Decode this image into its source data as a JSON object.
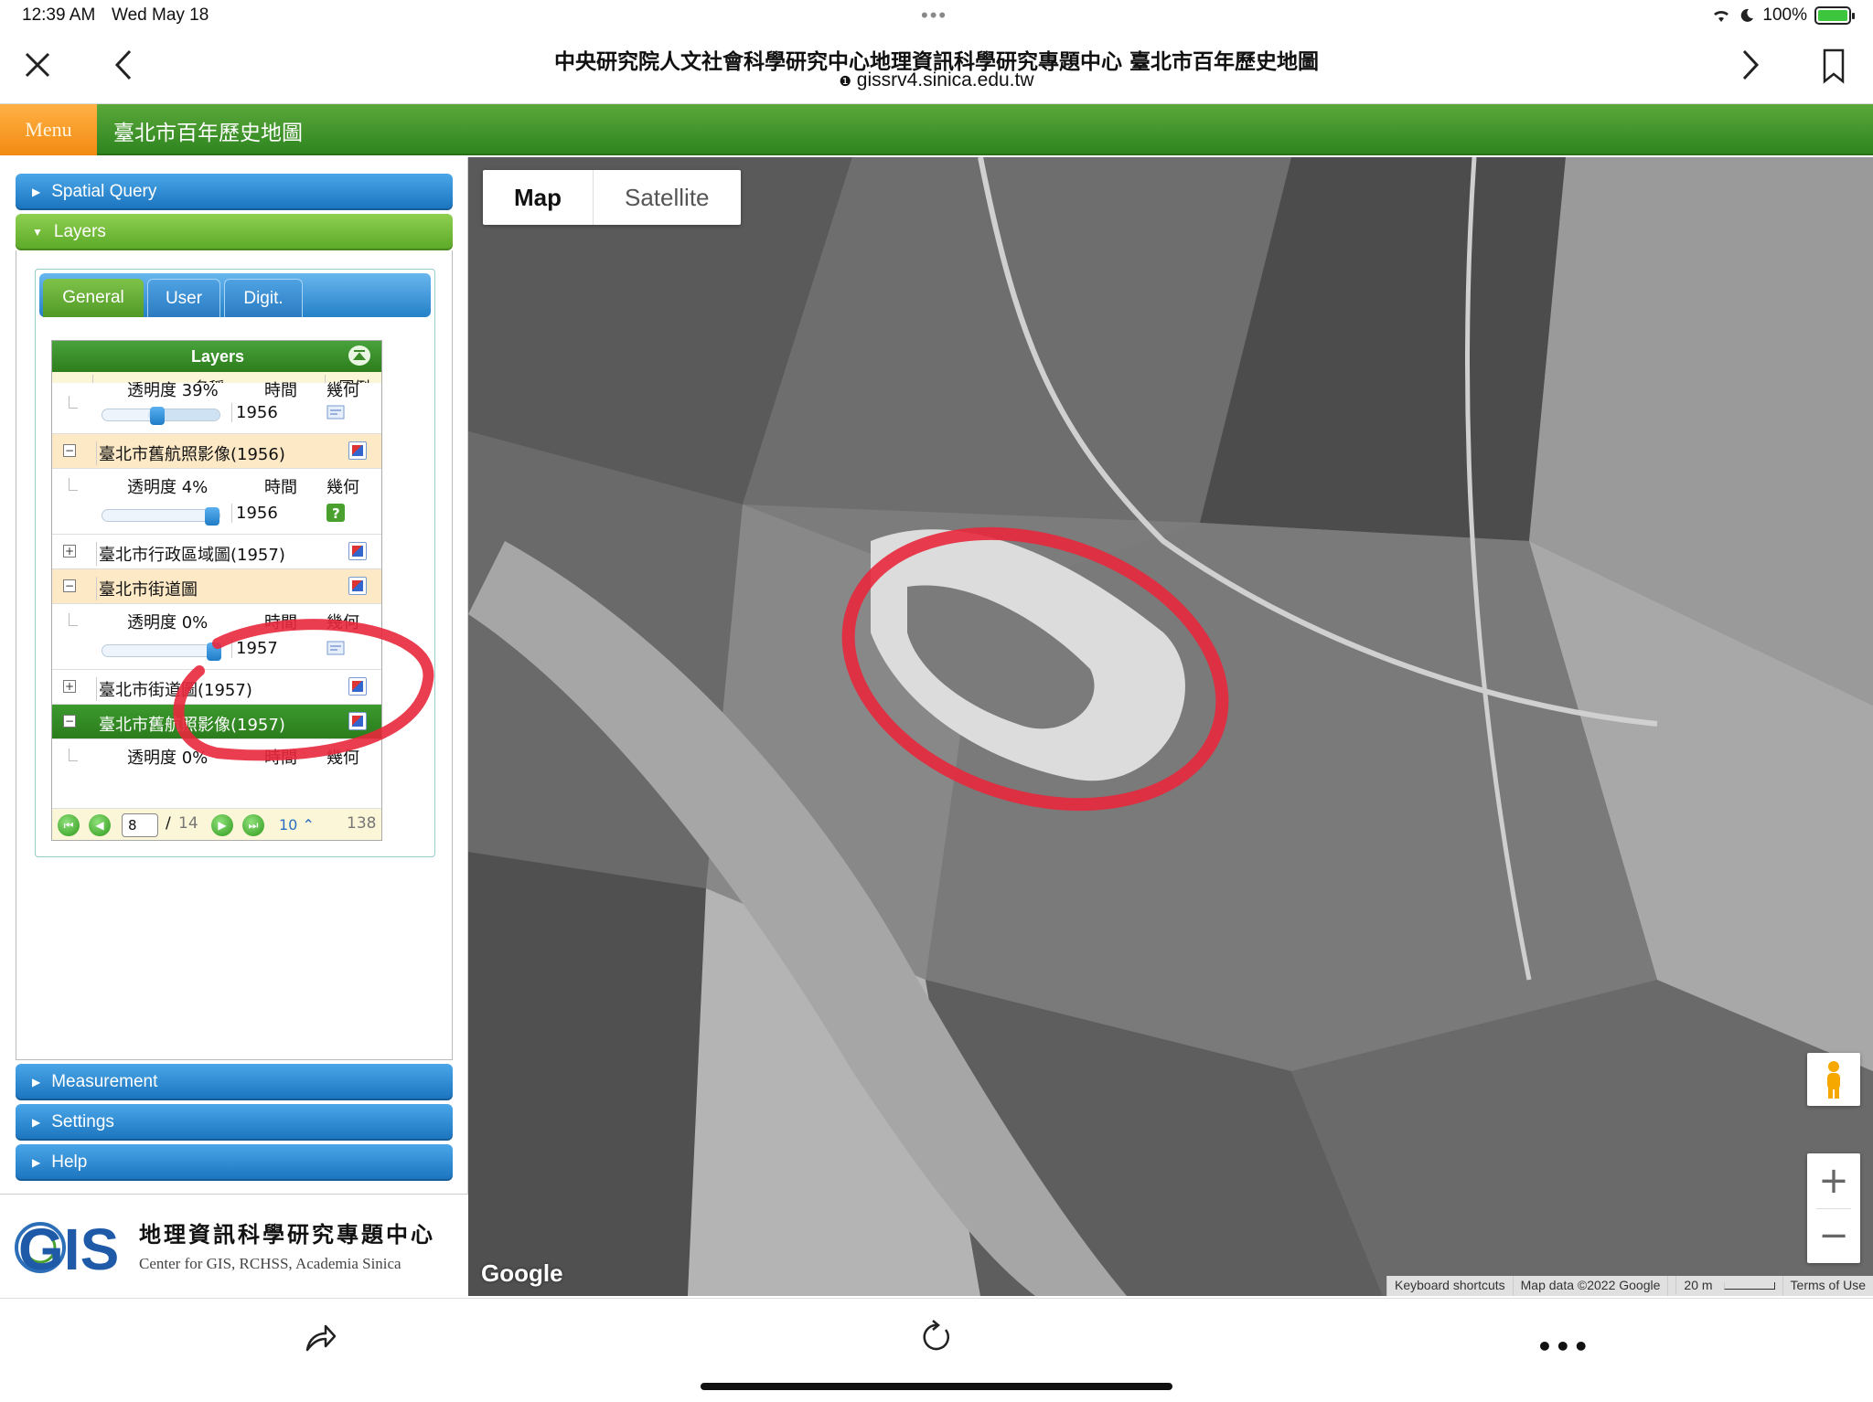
{
  "status": {
    "time": "12:39 AM",
    "date": "Wed May 18",
    "battery": "100%"
  },
  "browser": {
    "title": "中央研究院人文社會科學研究中心地理資訊科學研究專題中心 臺北市百年歷史地圖",
    "url": "gissrv4.sinica.edu.tw",
    "url_icon": "info-icon"
  },
  "app": {
    "menu_label": "Menu",
    "title": "臺北市百年歷史地圖"
  },
  "sidebar": {
    "spatial_query": "Spatial Query",
    "layers": "Layers",
    "measurement": "Measurement",
    "settings": "Settings",
    "help": "Help",
    "tabs": [
      "General",
      "User",
      "Digit."
    ]
  },
  "layers_table": {
    "header": "Layers",
    "col_name": "名稱",
    "col_legend": "圖例",
    "partial_row": {
      "opacity_label": "透明度 39%",
      "time_label": "時間",
      "geo_label": "幾何",
      "opacity_value": 39,
      "year": "1956"
    },
    "rows": [
      {
        "name": "臺北市舊航照影像(1956)",
        "expanded": true,
        "style": "orange",
        "opacity_label": "透明度 4%",
        "opacity_value": 4,
        "time_label": "時間",
        "geo_label": "幾何",
        "year": "1956"
      },
      {
        "name": "臺北市行政區域圖(1957)",
        "expanded": false,
        "style": "white"
      },
      {
        "name": "臺北市街道圖",
        "expanded": true,
        "style": "orange",
        "opacity_label": "透明度 0%",
        "opacity_value": 0,
        "time_label": "時間",
        "geo_label": "幾何",
        "year": "1957"
      },
      {
        "name": "臺北市街道圖(1957)",
        "expanded": false,
        "style": "white"
      },
      {
        "name": "臺北市舊航照影像(1957)",
        "expanded": true,
        "style": "selected",
        "opacity_label": "透明度 0%",
        "time_label": "時間",
        "geo_label": "幾何"
      }
    ],
    "pager": {
      "page": "8",
      "slash": "/",
      "total": "14",
      "per_page": "10",
      "count": "138"
    }
  },
  "gis_logo": {
    "mark": "GIS",
    "cn": "地理資訊科學研究專題中心",
    "en": "Center for GIS, RCHSS, Academia Sinica"
  },
  "map": {
    "type_map": "Map",
    "type_satellite": "Satellite",
    "google": "Google",
    "keyboard_shortcuts": "Keyboard shortcuts",
    "map_data": "Map data ©2022 Google",
    "scale": "20 m",
    "terms": "Terms of Use",
    "zoom_in": "+",
    "zoom_out": "−"
  },
  "colors": {
    "app_green": "#3a9428",
    "menu_orange": "#f59a22",
    "bar_blue": "#1f7cc6",
    "highlight_red": "#e8283c"
  }
}
